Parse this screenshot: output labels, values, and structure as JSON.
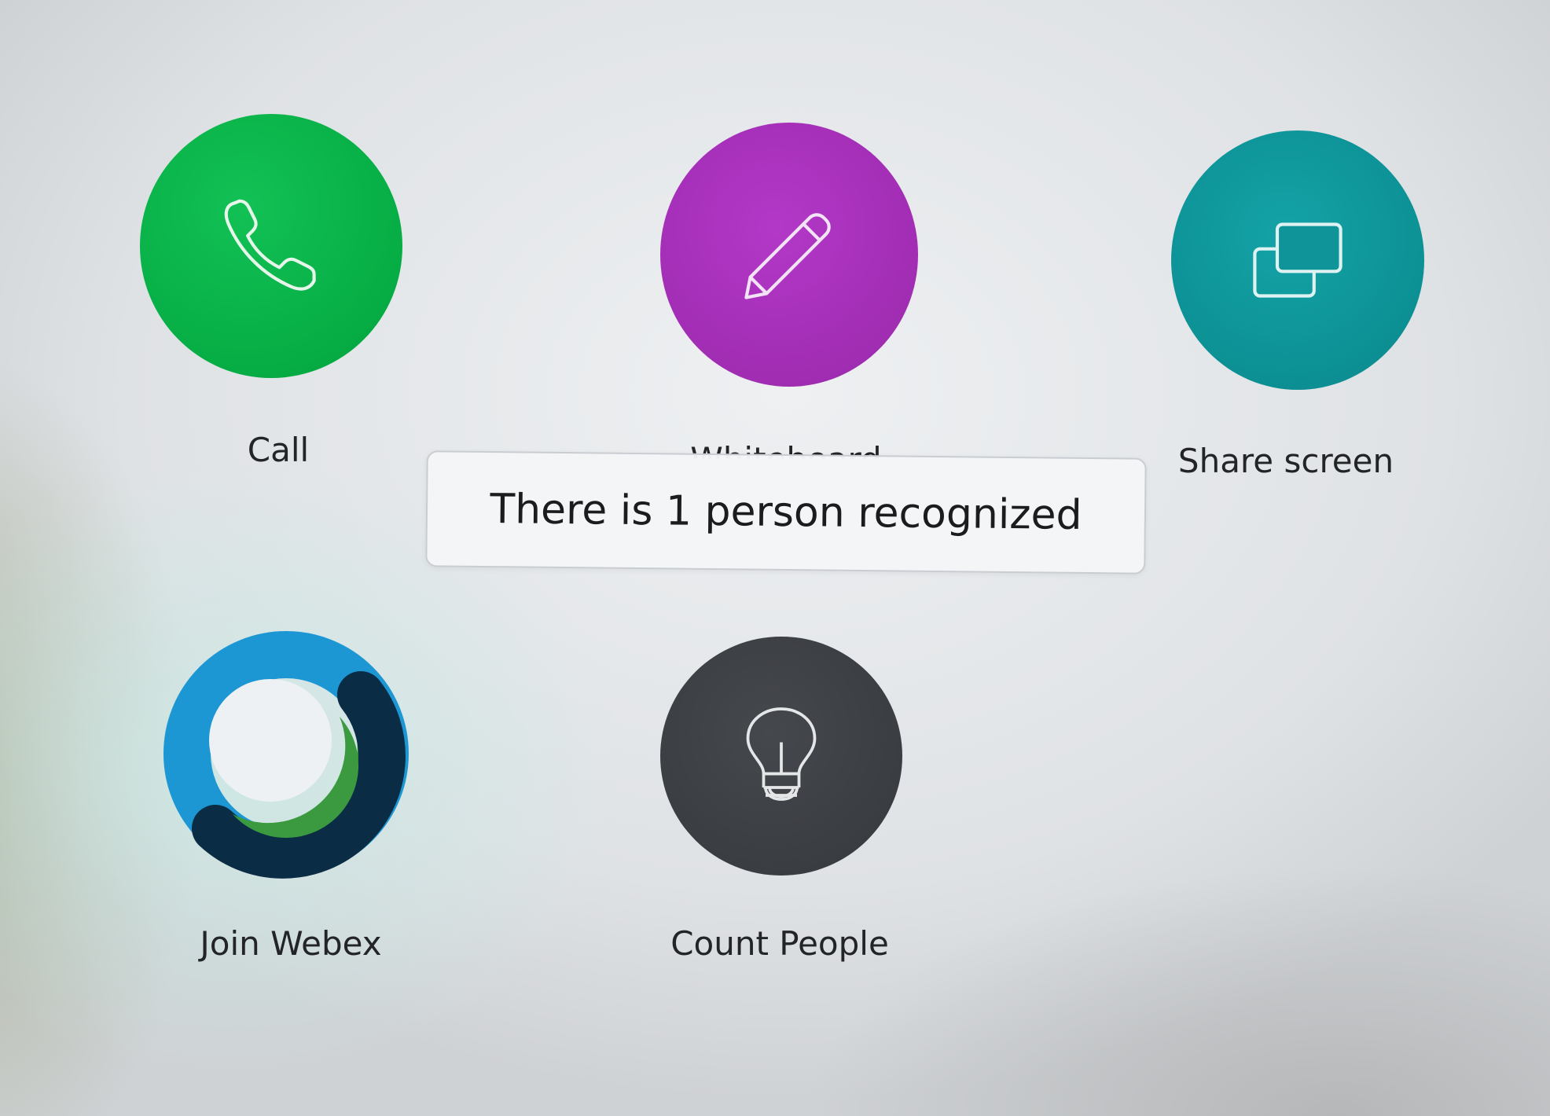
{
  "tiles": {
    "call": {
      "label": "Call",
      "icon": "phone-icon",
      "color": "#08b348"
    },
    "whiteboard": {
      "label": "Whiteboard",
      "icon": "pencil-icon",
      "color": "#a62fb8"
    },
    "share_screen": {
      "label": "Share screen",
      "icon": "share-screen-icon",
      "color": "#0e9499"
    },
    "join_webex": {
      "label": "Join Webex",
      "icon": "webex-logo-icon",
      "colors": [
        "#1e9ad6",
        "#2f9a3c",
        "#0b2c45"
      ]
    },
    "count_people": {
      "label": "Count People",
      "icon": "lightbulb-icon",
      "color": "#3c3f44"
    }
  },
  "notification": {
    "text": "There is 1 person recognized"
  }
}
